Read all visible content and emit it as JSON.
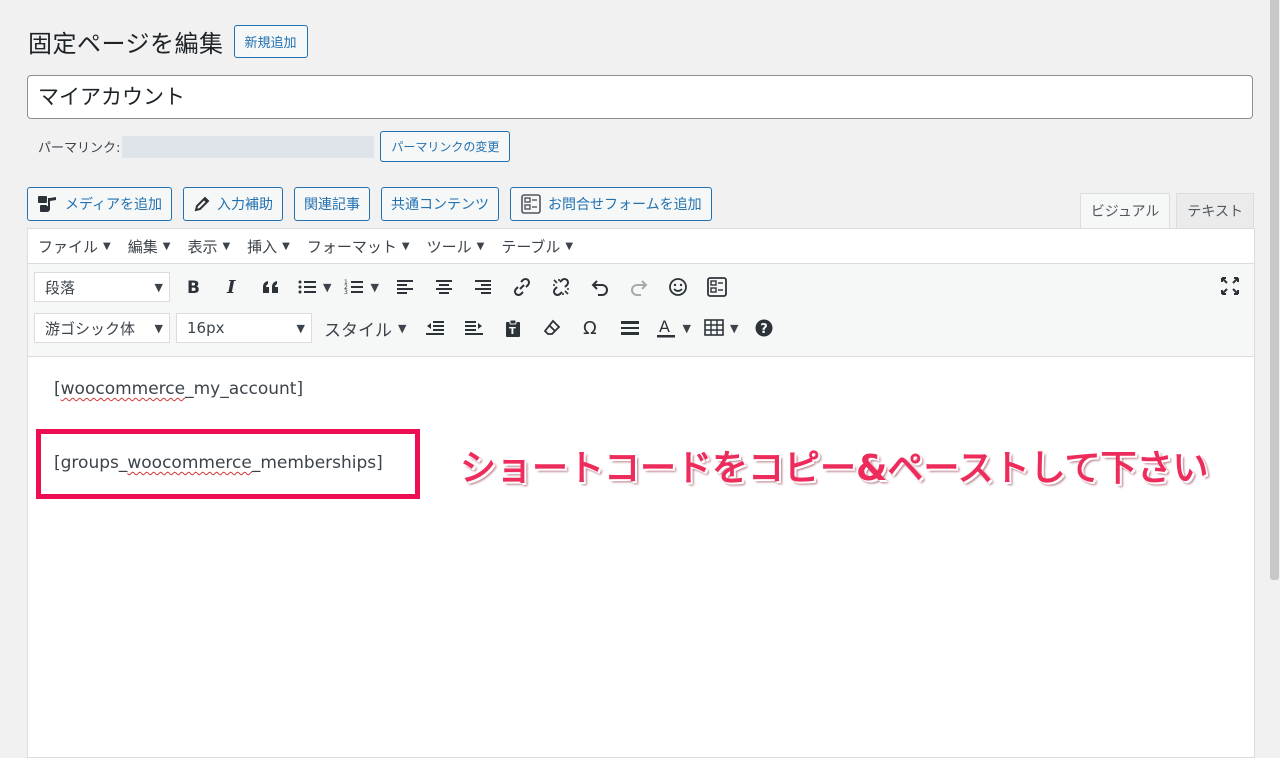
{
  "header": {
    "title": "固定ページを編集",
    "add_new": "新規追加"
  },
  "post_title": "マイアカウント",
  "permalink": {
    "label": "パーマリンク:",
    "change_button": "パーマリンクの変更"
  },
  "media_buttons": [
    {
      "label": "メディアを追加",
      "icon": "media-icon"
    },
    {
      "label": "入力補助",
      "icon": "pencil-icon"
    },
    {
      "label": "関連記事"
    },
    {
      "label": "共通コンテンツ"
    },
    {
      "label": "お問合せフォームを追加",
      "icon": "form-icon"
    }
  ],
  "mode_tabs": {
    "visual": "ビジュアル",
    "text": "テキスト",
    "active": "visual"
  },
  "menubar": [
    "ファイル",
    "編集",
    "表示",
    "挿入",
    "フォーマット",
    "ツール",
    "テーブル"
  ],
  "toolbar": {
    "format_select": "段落",
    "font_select": "游ゴシック体",
    "size_select": "16px",
    "style_label": "スタイル"
  },
  "content": {
    "shortcode_1_open": "[",
    "shortcode_1_word": "woocommerce",
    "shortcode_1_rest": "_my_account]",
    "shortcode_2_open": "[groups_",
    "shortcode_2_word": "woocommerce",
    "shortcode_2_rest": "_memberships]"
  },
  "annotation": "ショートコードをコピー&ペーストして下さい",
  "colors": {
    "accent": "#2271b1",
    "highlight": "#ee0c52",
    "annotation": "#ee2c5c"
  }
}
